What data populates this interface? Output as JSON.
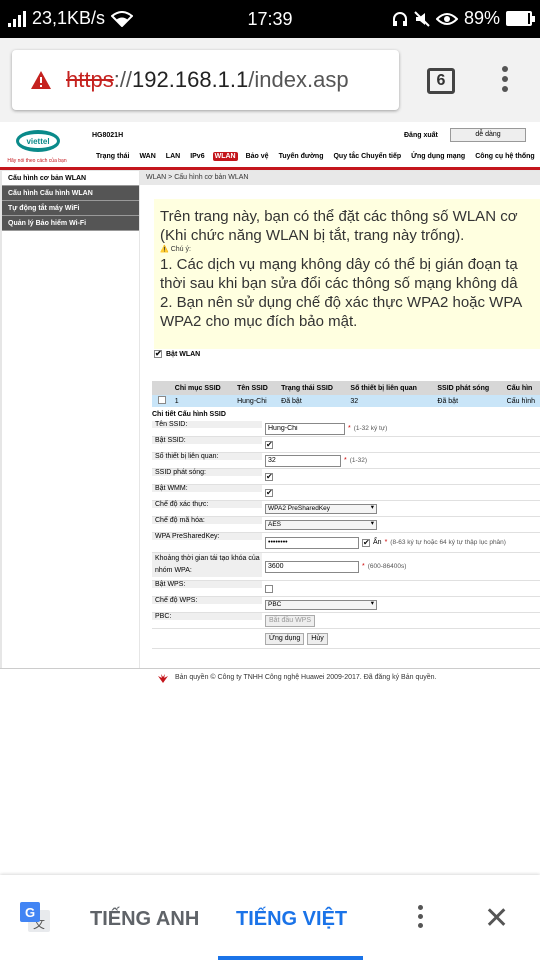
{
  "status_bar": {
    "net_speed": "23,1KB/s",
    "time": "17:39",
    "battery": "89%",
    "battery_level": 0.89
  },
  "browser": {
    "url_scheme": "https",
    "url_sep": "://",
    "url_host": "192.168.1.1",
    "url_path": "/index.asp",
    "tab_count": "6"
  },
  "router": {
    "brand_tagline": "Hãy nói theo cách của bạn",
    "model": "HG8021H",
    "logout": "Đăng xuất",
    "mode": "dễ dàng",
    "nav": [
      "Trạng thái",
      "WAN",
      "LAN",
      "IPv6",
      "WLAN",
      "Bảo vệ",
      "Tuyến đường",
      "Quy tắc Chuyển tiếp",
      "Ứng dụng mạng",
      "Công cụ hệ thống"
    ],
    "active_nav": "WLAN",
    "sidebar": [
      "Cấu hình cơ bản WLAN",
      "Cấu hình Cấu hình WLAN",
      "Tự động tắt máy WiFi",
      "Quản lý Bảo hiểm Wi-Fi"
    ],
    "breadcrumb": "WLAN > Cấu hình cơ bản WLAN",
    "info": {
      "line1": "Trên trang này, bạn có thể đặt các thông số WLAN cơ",
      "line2": "(Khi chức năng WLAN bị tắt, trang này trống).",
      "note_label": "Chú ý:",
      "line3": "1. Các dịch vụ mạng không dây có thể bị gián đoạn tạ",
      "line4": "thời sau khi bạn sửa đổi các thông số mạng không dâ",
      "line5": "2. Bạn nên sử dụng chế độ xác thực WPA2 hoặc WPA",
      "line6": "WPA2 cho mục đích bảo mật."
    },
    "enable_wlan": "Bật WLAN",
    "table": {
      "headers": [
        "Chỉ mục SSID",
        "Tên SSID",
        "Trạng thái SSID",
        "Số thiết bị liên quan",
        "SSID phát sóng",
        "Cấu hìn"
      ],
      "row": [
        "1",
        "Hung-Chi",
        "Đã bật",
        "32",
        "Đã bật",
        "Cấu hình"
      ]
    },
    "details_title": "Chi tiết Cấu hình SSID",
    "form": {
      "ssid_label": "Tên SSID:",
      "ssid_value": "Hung-Chi",
      "ssid_hint": "(1-32 ký tự)",
      "enable_ssid_label": "Bật SSID:",
      "devices_label": "Số thiết bị liên quan:",
      "devices_value": "32",
      "devices_hint": "(1-32)",
      "broadcast_label": "SSID phát sóng:",
      "wmm_label": "Bật WMM:",
      "auth_label": "Chế độ xác thực:",
      "auth_value": "WPA2 PreSharedKey",
      "enc_label": "Chế độ mã hóa:",
      "enc_value": "AES",
      "psk_label": "WPA PreSharedKey:",
      "psk_value": "••••••••",
      "psk_hide": "Ẩn",
      "psk_hint": "(8-63 ký tự hoặc 64 ký tự thập lục phân)",
      "rekey_label": "Khoảng thời gian tái tạo khóa của nhóm WPA:",
      "rekey_value": "3600",
      "rekey_hint": "(600-86400s)",
      "wps_label": "Bật WPS:",
      "wps_mode_label": "Chế độ WPS:",
      "wps_mode_value": "PBC",
      "pbc_label": "PBC:",
      "pbc_button": "Bắt đầu WPS",
      "apply": "Ứng dụng",
      "cancel": "Hủy"
    },
    "footer": "Bản quyền © Công ty TNHH Công nghệ Huawei 2009-2017. Đã đăng ký Bản quyền."
  },
  "translate_bar": {
    "source_lang": "TIẾNG ANH",
    "target_lang": "TIẾNG VIỆT",
    "active": "TIẾNG VIỆT"
  },
  "colors": {
    "brand_red": "#c4161c",
    "translate_blue": "#1a73e8",
    "info_bg": "#ffffe0"
  }
}
